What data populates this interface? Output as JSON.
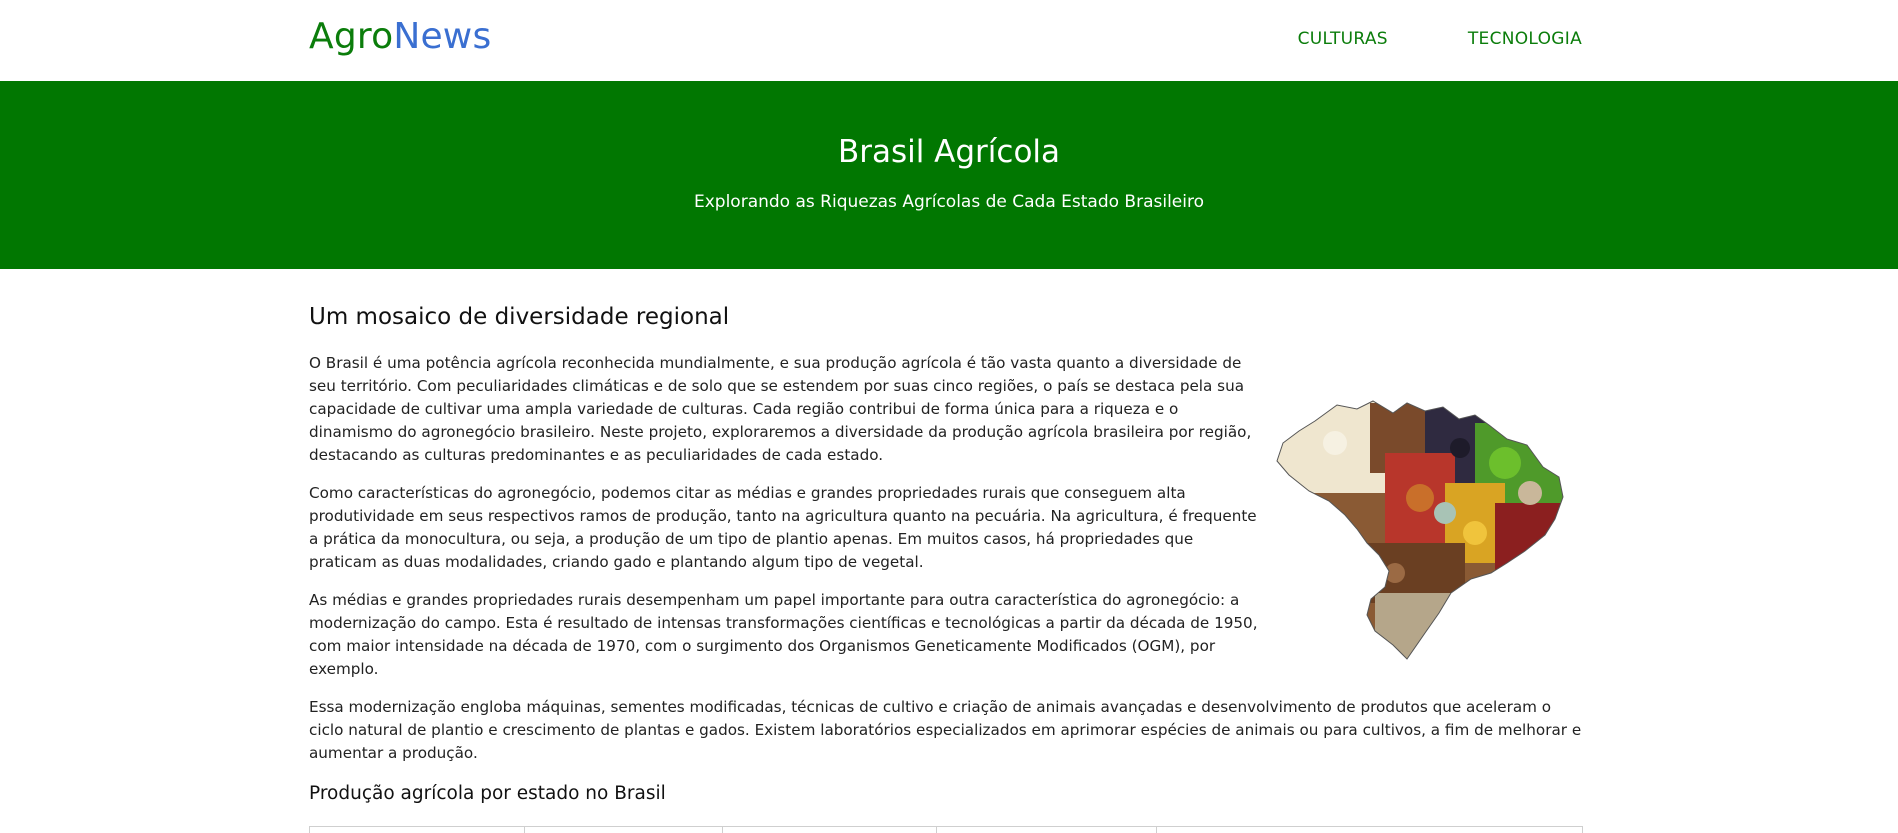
{
  "header": {
    "logo_part1": "Agro",
    "logo_part2": "News",
    "nav": [
      {
        "label": "CULTURAS"
      },
      {
        "label": "TECNOLOGIA"
      }
    ]
  },
  "hero": {
    "title": "Brasil Agrícola",
    "subtitle": "Explorando as Riquezas Agrícolas de Cada Estado Brasileiro"
  },
  "main": {
    "heading": "Um mosaico de diversidade regional",
    "paragraphs": [
      "O Brasil é uma potência agrícola reconhecida mundialmente, e sua produção agrícola é tão vasta quanto a diversidade de seu território. Com peculiaridades climáticas e de solo que se estendem por suas cinco regiões, o país se destaca pela sua capacidade de cultivar uma ampla variedade de culturas. Cada região contribui de forma única para a riqueza e o dinamismo do agronegócio brasileiro. Neste projeto, exploraremos a diversidade da produção agrícola brasileira por região, destacando as culturas predominantes e as peculiaridades de cada estado.",
      "Como características do agronegócio, podemos citar as médias e grandes propriedades rurais que conseguem alta produtividade em seus respectivos ramos de produção, tanto na agricultura quanto na pecuária. Na agricultura, é frequente a prática da monocultura, ou seja, a produção de um tipo de plantio apenas. Em muitos casos, há propriedades que praticam as duas modalidades, criando gado e plantando algum tipo de vegetal.",
      "As médias e grandes propriedades rurais desempenham um papel importante para outra característica do agronegócio: a modernização do campo. Esta é resultado de intensas transformações científicas e tecnológicas a partir da década de 1950, com maior intensidade na década de 1970, com o surgimento dos Organismos Geneticamente Modificados (OGM), por exemplo.",
      "Essa modernização engloba máquinas, sementes modificadas, técnicas de cultivo e criação de animais avançadas e desenvolvimento de produtos que aceleram o ciclo natural de plantio e crescimento de plantas e gados. Existem laboratórios especializados em aprimorar espécies de animais ou para cultivos, a fim de melhorar e aumentar a produção."
    ],
    "subheading": "Produção agrícola por estado no Brasil"
  },
  "colors": {
    "brand_green": "#017701",
    "logo_blue": "#3a6fd1",
    "nav_green": "#0b7d0b"
  }
}
